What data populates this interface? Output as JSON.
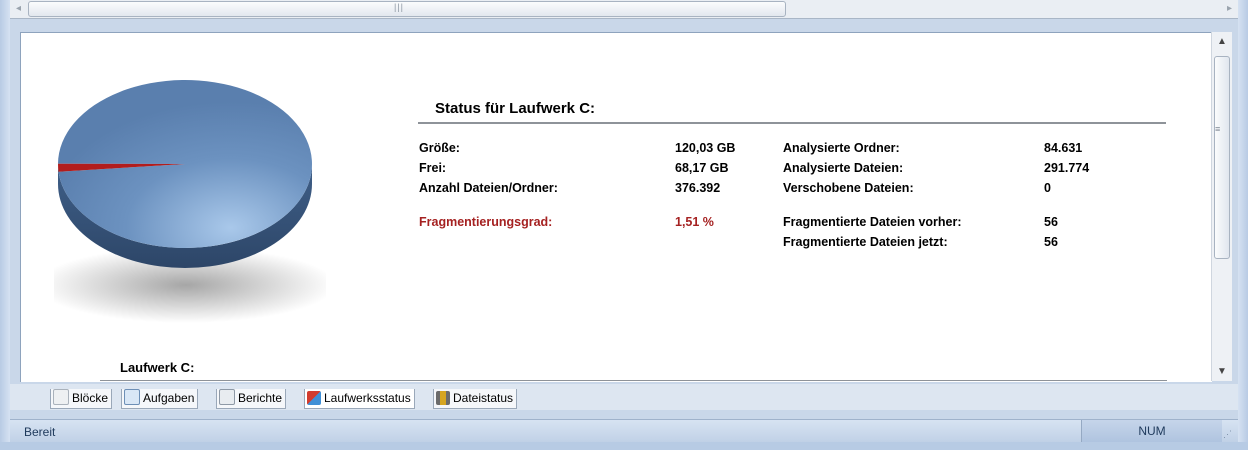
{
  "status": {
    "title": "Status für Laufwerk C:",
    "left_column": [
      {
        "label": "Größe:",
        "value": "120,03 GB"
      },
      {
        "label": "Frei:",
        "value": "68,17 GB"
      },
      {
        "label": "Anzahl Dateien/Ordner:",
        "value": "376.392"
      }
    ],
    "fragmentation": {
      "label": "Fragmentierungsgrad:",
      "value": "1,51 %"
    },
    "right_column": [
      {
        "label": "Analysierte Ordner:",
        "value": "84.631"
      },
      {
        "label": "Analysierte Dateien:",
        "value": "291.774"
      },
      {
        "label": "Verschobene Dateien:",
        "value": "0"
      },
      {
        "label": "Fragmentierte Dateien vorher:",
        "value": "56"
      },
      {
        "label": "Fragmentierte Dateien jetzt:",
        "value": "56"
      }
    ]
  },
  "drive_caption": "Laufwerk C:",
  "tabs": [
    {
      "label": "Blöcke",
      "icon": "blocks-icon"
    },
    {
      "label": "Aufgaben",
      "icon": "tasks-icon"
    },
    {
      "label": "Berichte",
      "icon": "reports-icon"
    },
    {
      "label": "Laufwerksstatus",
      "icon": "drive-status-icon",
      "active": true
    },
    {
      "label": "Dateistatus",
      "icon": "file-status-icon"
    }
  ],
  "statusbar": {
    "ready": "Bereit",
    "num": "NUM"
  },
  "chart_data": {
    "type": "pie",
    "values": [
      98.49,
      1.51
    ],
    "colors": [
      "#5f86b5",
      "#b21d1d"
    ]
  },
  "colors": {
    "accent_red": "#a52121",
    "pie_blue": "#5f86b5",
    "pie_red": "#b21d1d"
  }
}
